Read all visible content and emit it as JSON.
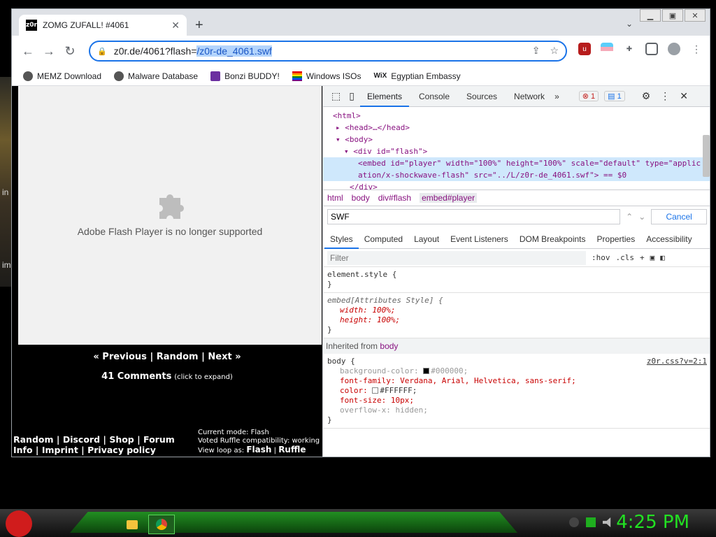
{
  "browser": {
    "tab_title": "ZOMG ZUFALL! #4061",
    "favicon_text": "z0r",
    "url_base": "z0r.de/4061?flash=",
    "url_selected": "/z0r-de_4061.swf",
    "bookmarks": [
      {
        "label": "MEMZ Download",
        "icon": "globe-icon"
      },
      {
        "label": "Malware Database",
        "icon": "globe-icon"
      },
      {
        "label": "Bonzi BUDDY!",
        "icon": "bonzi-icon"
      },
      {
        "label": "Windows ISOs",
        "icon": "rainbow-flag-icon"
      },
      {
        "label": "Egyptian Embassy",
        "icon": "wix-icon"
      }
    ]
  },
  "page": {
    "flash_message": "Adobe Flash Player is no longer supported",
    "nav": {
      "previous": "« Previous",
      "random": "Random",
      "next": "Next »"
    },
    "comments_count": "41 Comments",
    "comments_hint": "(click to expand)",
    "footer_links": [
      "Random",
      "Discord",
      "Shop",
      "Forum",
      "Info",
      "Imprint",
      "Privacy policy"
    ],
    "mode_line": "Current mode: Flash",
    "ruffle_line": "Voted Ruffle compatibility: working",
    "loop_label": "View loop as:",
    "loop_options": [
      "Flash",
      "Ruffle"
    ]
  },
  "devtools": {
    "tabs": [
      "Elements",
      "Console",
      "Sources",
      "Network"
    ],
    "error_count": "1",
    "message_count": "1",
    "dom_lines": [
      "<html>",
      "<head>…</head>",
      "<body>",
      "<div id=\"flash\">",
      "<embed id=\"player\" width=\"100%\" height=\"100%\" scale=\"default\" type=\"applic",
      "ation/x-shockwave-flash\" src=\"../L/z0r-de_4061.swf\"> == $0",
      "</div>"
    ],
    "breadcrumbs": [
      "html",
      "body",
      "div#flash",
      "embed#player"
    ],
    "search_value": "SWF",
    "cancel_label": "Cancel",
    "style_tabs": [
      "Styles",
      "Computed",
      "Layout",
      "Event Listeners",
      "DOM Breakpoints",
      "Properties",
      "Accessibility"
    ],
    "filter_placeholder": "Filter",
    "filter_hov": ":hov",
    "filter_cls": ".cls",
    "rule_element": "element.style {",
    "rule_embed": "embed[Attributes Style] {",
    "embed_width": "width: 100%;",
    "embed_height": "height: 100%;",
    "inherited_label": "Inherited from",
    "inherited_from": "body",
    "body_selector": "body {",
    "body_source": "z0r.css?v=2:1",
    "body_bg": "background-color:",
    "body_bg_val": "#000000;",
    "body_font": "font-family: Verdana, Arial, Helvetica, sans-serif;",
    "body_color": "color:",
    "body_color_val": "#FFFFFF;",
    "body_fontsize": "font-size: 10px;",
    "body_overflow": "overflow-x: hidden;",
    "close_brace": "}"
  },
  "desktop": {
    "left_text_1": "in",
    "left_text_2": "im"
  },
  "taskbar": {
    "clock": "4:25 PM"
  },
  "colors": {
    "clock": "#22e122",
    "accent": "#1a73e8"
  }
}
